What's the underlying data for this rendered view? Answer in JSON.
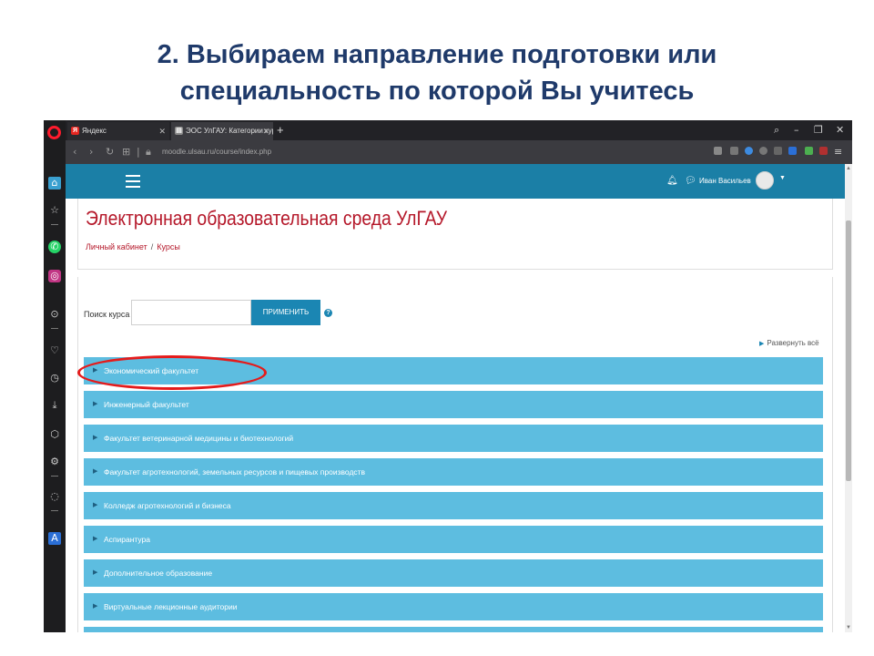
{
  "slide": {
    "title_line1": "2. Выбираем направление подготовки или",
    "title_line2": "специальность по которой Вы учитесь"
  },
  "browser": {
    "tabs": [
      {
        "label": "Яндекс",
        "favicon": "Я"
      },
      {
        "label": "ЭОС УлГАУ: Категории курс",
        "favicon": "▤"
      }
    ],
    "new_tab": "+",
    "url": "moodle.ulsau.ru/course/index.php"
  },
  "moodle": {
    "user_name": "Иван Васильев",
    "site_name": "Электронная образовательная среда УлГАУ",
    "breadcrumb": [
      "Личный кабинет",
      "Курсы"
    ],
    "search": {
      "label": "Поиск курса",
      "value": "",
      "button": "ПРИМЕНИТЬ"
    },
    "expand_all": "Развернуть всё",
    "categories": [
      "Экономический факультет",
      "Инженерный факультет",
      "Факультет ветеринарной медицины и биотехнологий",
      "Факультет агротехнологий, земельных ресурсов и пищевых производств",
      "Колледж агротехнологий и бизнеса",
      "Аспирантура",
      "Дополнительное образование",
      "Виртуальные лекционные аудитории"
    ]
  },
  "colors": {
    "title": "#1f3a6a",
    "navbar": "#1b7fa6",
    "category_bg": "#5dbde0",
    "brand_red": "#b5182a",
    "highlight": "#e51b1b"
  }
}
